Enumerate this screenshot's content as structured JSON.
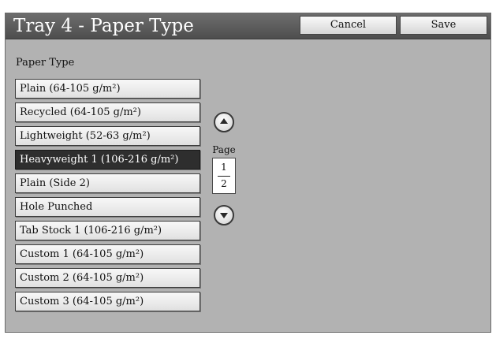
{
  "header": {
    "title": "Tray 4 - Paper Type",
    "cancel_label": "Cancel",
    "save_label": "Save"
  },
  "section_label": "Paper Type",
  "paper_types": [
    {
      "label": "Plain (64-105 g/m²)",
      "selected": false
    },
    {
      "label": "Recycled (64-105 g/m²)",
      "selected": false
    },
    {
      "label": "Lightweight (52-63 g/m²)",
      "selected": false
    },
    {
      "label": "Heavyweight 1 (106-216 g/m²)",
      "selected": true
    },
    {
      "label": "Plain (Side 2)",
      "selected": false
    },
    {
      "label": "Hole Punched",
      "selected": false
    },
    {
      "label": "Tab Stock 1 (106-216 g/m²)",
      "selected": false
    },
    {
      "label": "Custom 1 (64-105 g/m²)",
      "selected": false
    },
    {
      "label": "Custom 2 (64-105 g/m²)",
      "selected": false
    },
    {
      "label": "Custom 3 (64-105 g/m²)",
      "selected": false
    }
  ],
  "pager": {
    "label": "Page",
    "current": "1",
    "total": "2",
    "up_icon": "up-arrow-icon",
    "down_icon": "down-arrow-icon"
  },
  "colors": {
    "screen_bg": "#b2b2b2",
    "titlebar_bg": "#5a5a5a",
    "selected_bg": "#2e2e2e",
    "selected_text": "#ffffff"
  }
}
